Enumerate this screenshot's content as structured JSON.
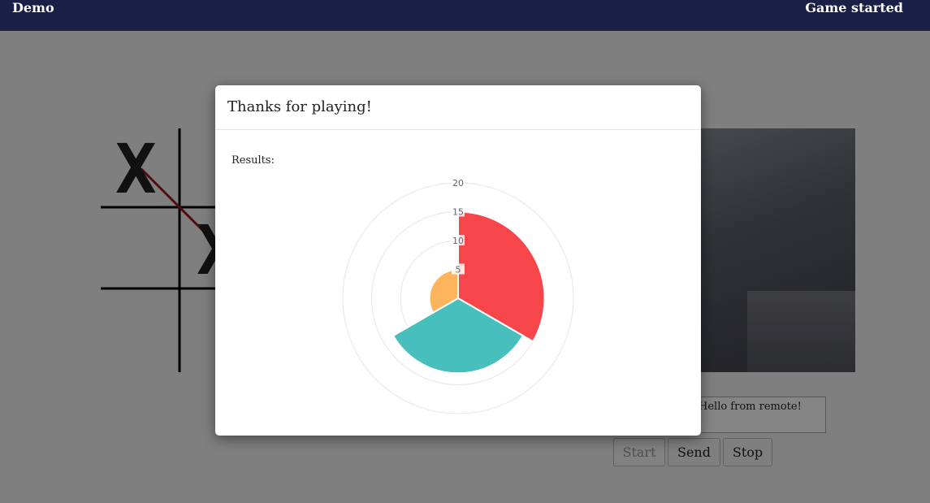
{
  "navbar": {
    "brand": "Demo",
    "status": "Game started"
  },
  "board": {
    "marks": [
      "X",
      "X"
    ]
  },
  "chat": {
    "message": "Hello from remote!"
  },
  "controls": {
    "start_label": "Start",
    "send_label": "Send",
    "stop_label": "Stop"
  },
  "modal": {
    "title": "Thanks for playing!",
    "results_label": "Results:"
  },
  "chart_data": {
    "type": "polar-area",
    "ticks": [
      "5",
      "10",
      "15",
      "20"
    ],
    "rmax": 20,
    "segments": [
      {
        "value": 15,
        "color": "#f7464a"
      },
      {
        "value": 13,
        "color": "#46bfbd"
      },
      {
        "value": 5,
        "color": "#fdb45c"
      }
    ]
  },
  "colors": {
    "navbar": "#1a1f46",
    "overlay": "rgba(0,0,0,0.48)"
  }
}
